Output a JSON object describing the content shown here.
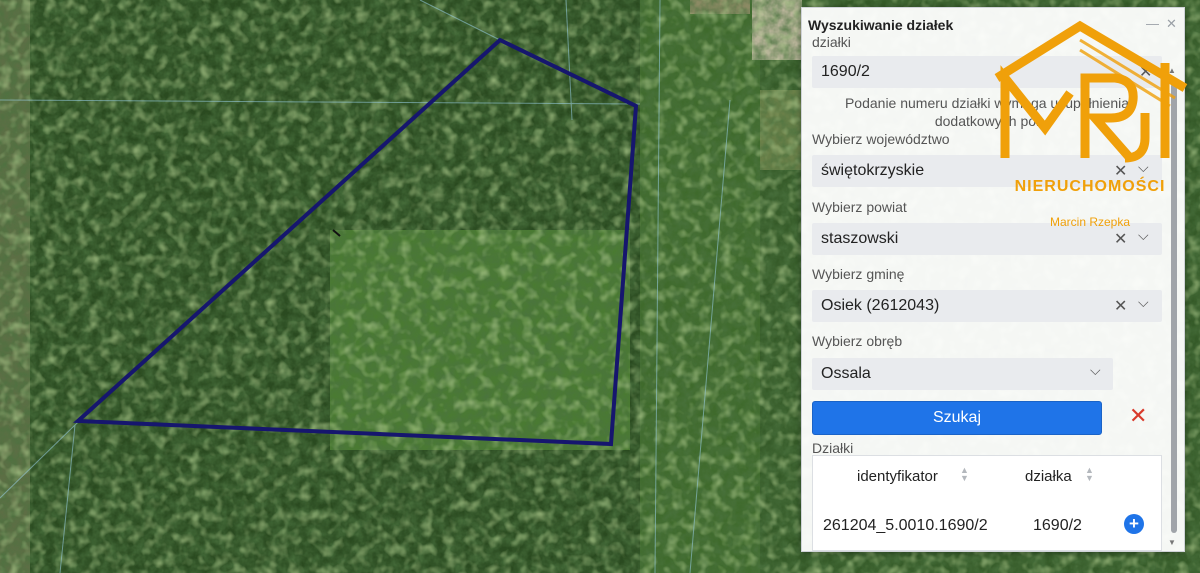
{
  "panel": {
    "title": "Wyszukiwanie działek",
    "parcel_label": "działki",
    "parcel_value": "1690/2",
    "hint": "Podanie numeru działki wymaga uzupełnienia dodatkowych pól",
    "voivodeship_label": "Wybierz województwo",
    "voivodeship_value": "świętokrzyskie",
    "county_label": "Wybierz powiat",
    "county_value": "staszowski",
    "commune_label": "Wybierz gminę",
    "commune_value": "Osiek (2612043)",
    "precinct_label": "Wybierz obręb",
    "precinct_value": "Ossala",
    "search_button": "Szukaj",
    "results_label": "Działki",
    "columns": [
      "identyfikator",
      "działka"
    ],
    "rows": [
      {
        "id": "261204_5.0010.1690/2",
        "parcel": "1690/2"
      }
    ]
  },
  "watermark": {
    "brand": "NIERUCHOMOŚCI",
    "owner": "Marcin Rzepka"
  },
  "colors": {
    "parcel_outline": "#16166e",
    "accent": "#1f74e8",
    "logo": "#f0a00a",
    "reset": "#d93a2b"
  },
  "icons": {
    "clear": "close-icon",
    "dropdown": "chevron-down-icon",
    "sort": "sort-icon",
    "add": "plus-circle-icon",
    "reset": "close-icon"
  }
}
